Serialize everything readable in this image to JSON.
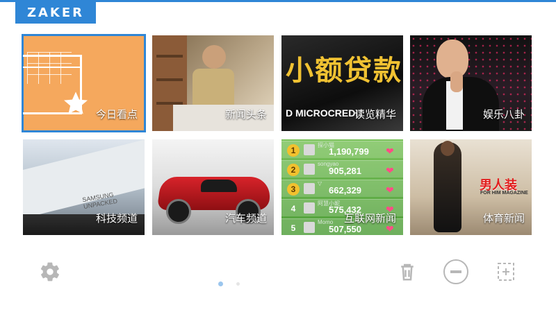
{
  "header": {
    "logo": "ZAKER"
  },
  "tiles": [
    {
      "label": "今日看点"
    },
    {
      "label": "新闻头条"
    },
    {
      "label": "读览精华",
      "image_text_big": "小额贷款",
      "image_text_small": "D MICROCREDIT"
    },
    {
      "label": "娱乐八卦"
    },
    {
      "label": "科技频道",
      "image_text": "SAMSUNG\nUNPACKED"
    },
    {
      "label": "汽车频道"
    },
    {
      "label": "互联网新闻",
      "leaderboard": [
        {
          "rank": "1",
          "name": "探小猫",
          "score": "1,190,799"
        },
        {
          "rank": "2",
          "name": "songyao",
          "score": "905,281"
        },
        {
          "rank": "3",
          "name": "▽",
          "score": "662,329"
        },
        {
          "rank": "4",
          "name": "阿慧小妮",
          "score": "575,432"
        },
        {
          "rank": "5",
          "name": "Momo",
          "score": "507,550"
        }
      ]
    },
    {
      "label": "体育新闻",
      "mag_title": "男人装",
      "mag_sub": "FOR HIM MAGAZINE"
    }
  ],
  "pager": {
    "active_index": 0,
    "count": 2
  },
  "colors": {
    "accent": "#2f86d6",
    "tile1": "#f5a85d",
    "icon_gray": "#b7b7b7"
  },
  "icons": {
    "settings": "gear-icon",
    "delete": "trash-icon",
    "minus": "minus-circle-icon",
    "add": "add-square-icon"
  }
}
